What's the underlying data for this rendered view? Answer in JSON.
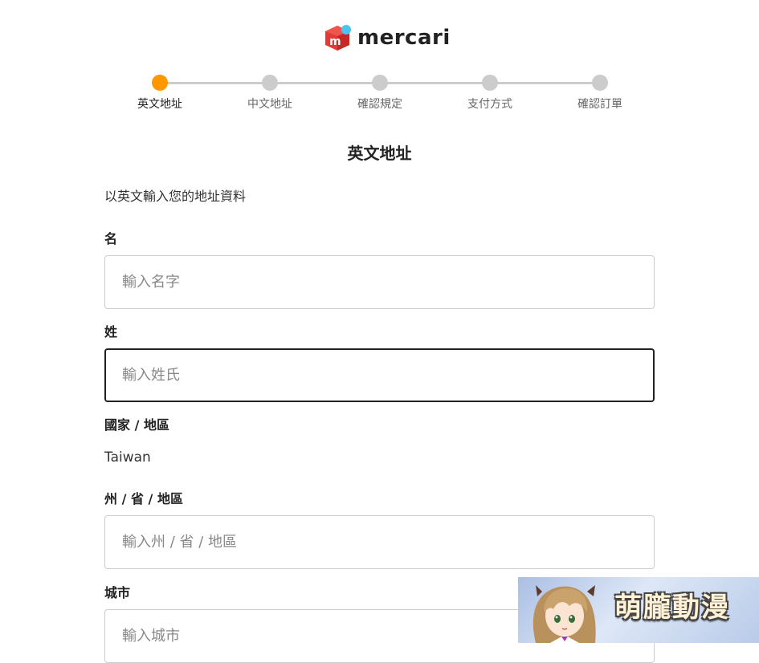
{
  "brand": {
    "name": "mercari",
    "colors": {
      "red": "#e53935",
      "blue": "#4dc3f0"
    }
  },
  "stepper": {
    "active_color": "#ff9800",
    "inactive_color": "#cccccc",
    "steps": [
      {
        "label": "英文地址",
        "active": true
      },
      {
        "label": "中文地址",
        "active": false
      },
      {
        "label": "確認規定",
        "active": false
      },
      {
        "label": "支付方式",
        "active": false
      },
      {
        "label": "確認訂單",
        "active": false
      }
    ]
  },
  "page": {
    "title": "英文地址",
    "intro": "以英文輸入您的地址資料"
  },
  "form": {
    "first_name": {
      "label": "名",
      "placeholder": "輸入名字",
      "value": ""
    },
    "last_name": {
      "label": "姓",
      "placeholder": "輸入姓氏",
      "value": "",
      "focused": true
    },
    "country": {
      "label": "國家 / 地區",
      "value": "Taiwan"
    },
    "state": {
      "label": "州 / 省 / 地區",
      "placeholder": "輸入州 / 省 / 地區",
      "value": ""
    },
    "city": {
      "label": "城市",
      "placeholder": "輸入城市",
      "value": ""
    }
  },
  "watermark": {
    "text": "萌朧動漫"
  }
}
